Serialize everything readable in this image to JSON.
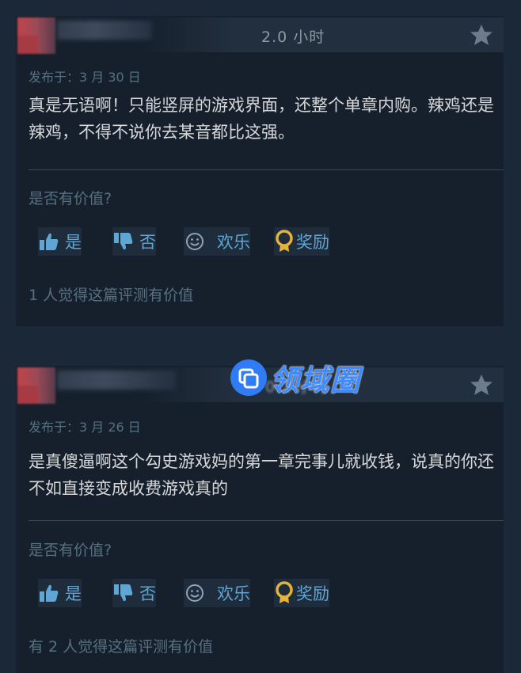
{
  "reviews": [
    {
      "hours": "2.0 小时",
      "posted": "发布于：3 月 30 日",
      "content": "真是无语啊！只能竖屏的游戏界面，还整个单章内购。辣鸡还是辣鸡，不得不说你去某音都比这强。",
      "helpful_question": "是否有价值?",
      "vote_yes": "是",
      "vote_no": "否",
      "vote_funny": "欢乐",
      "award": "奖励",
      "helpful_count": "1 人觉得这篇评测有价值"
    },
    {
      "hours": "0.2 小时",
      "posted": "发布于：3 月 26 日",
      "content": "是真傻逼啊这个勾史游戏妈的第一章完事儿就收钱，说真的你还不如直接变成收费游戏真的",
      "helpful_question": "是否有价值?",
      "vote_yes": "是",
      "vote_no": "否",
      "vote_funny": "欢乐",
      "award": "奖励",
      "helpful_count": "有 2 人觉得这篇评测有价值"
    }
  ],
  "watermark": {
    "text": "领域圈"
  },
  "colors": {
    "background": "#1b2838",
    "card": "#16202d",
    "vote_blue": "#5fa6d4",
    "muted": "#56707f",
    "text": "#d6d7d8"
  },
  "icons": {
    "thumbs_up": "thumbs-up-icon",
    "thumbs_down": "thumbs-down-icon",
    "funny": "smiley-icon",
    "award": "award-medal-icon",
    "recommend": "star-icon"
  }
}
